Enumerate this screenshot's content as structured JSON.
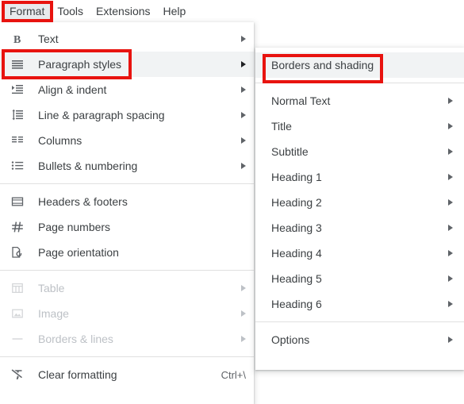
{
  "menubar": {
    "items": [
      {
        "label": "Format",
        "active": true
      },
      {
        "label": "Tools",
        "active": false
      },
      {
        "label": "Extensions",
        "active": false
      },
      {
        "label": "Help",
        "active": false
      }
    ]
  },
  "format_menu": {
    "items": [
      {
        "label": "Text",
        "icon": "bold-b-icon",
        "arrow": true,
        "disabled": false,
        "highlighted": false,
        "shortcut": ""
      },
      {
        "label": "Paragraph styles",
        "icon": "paragraph-lines-icon",
        "arrow": true,
        "disabled": false,
        "highlighted": true,
        "shortcut": ""
      },
      {
        "label": "Align & indent",
        "icon": "align-indent-icon",
        "arrow": true,
        "disabled": false,
        "highlighted": false,
        "shortcut": ""
      },
      {
        "label": "Line & paragraph spacing",
        "icon": "line-spacing-icon",
        "arrow": true,
        "disabled": false,
        "highlighted": false,
        "shortcut": ""
      },
      {
        "label": "Columns",
        "icon": "columns-icon",
        "arrow": true,
        "disabled": false,
        "highlighted": false,
        "shortcut": ""
      },
      {
        "label": "Bullets & numbering",
        "icon": "bullets-numbering-icon",
        "arrow": true,
        "disabled": false,
        "highlighted": false,
        "shortcut": ""
      },
      {
        "separator": true
      },
      {
        "label": "Headers & footers",
        "icon": "headers-footers-icon",
        "arrow": false,
        "disabled": false,
        "highlighted": false,
        "shortcut": ""
      },
      {
        "label": "Page numbers",
        "icon": "hash-icon",
        "arrow": false,
        "disabled": false,
        "highlighted": false,
        "shortcut": ""
      },
      {
        "label": "Page orientation",
        "icon": "page-orientation-icon",
        "arrow": false,
        "disabled": false,
        "highlighted": false,
        "shortcut": ""
      },
      {
        "separator": true
      },
      {
        "label": "Table",
        "icon": "table-icon",
        "arrow": true,
        "disabled": true,
        "highlighted": false,
        "shortcut": ""
      },
      {
        "label": "Image",
        "icon": "image-icon",
        "arrow": true,
        "disabled": true,
        "highlighted": false,
        "shortcut": ""
      },
      {
        "label": "Borders & lines",
        "icon": "borders-lines-icon",
        "arrow": true,
        "disabled": true,
        "highlighted": false,
        "shortcut": ""
      },
      {
        "separator": true
      },
      {
        "label": "Clear formatting",
        "icon": "clear-formatting-icon",
        "arrow": false,
        "disabled": false,
        "highlighted": false,
        "shortcut": "Ctrl+\\"
      }
    ]
  },
  "styles_submenu": {
    "items": [
      {
        "label": "Borders and shading",
        "arrow": false,
        "highlighted": true
      },
      {
        "separator": true
      },
      {
        "label": "Normal Text",
        "arrow": true,
        "highlighted": false
      },
      {
        "label": "Title",
        "arrow": true,
        "highlighted": false
      },
      {
        "label": "Subtitle",
        "arrow": true,
        "highlighted": false
      },
      {
        "label": "Heading 1",
        "arrow": true,
        "highlighted": false
      },
      {
        "label": "Heading 2",
        "arrow": true,
        "highlighted": false
      },
      {
        "label": "Heading 3",
        "arrow": true,
        "highlighted": false
      },
      {
        "label": "Heading 4",
        "arrow": true,
        "highlighted": false
      },
      {
        "label": "Heading 5",
        "arrow": true,
        "highlighted": false
      },
      {
        "label": "Heading 6",
        "arrow": true,
        "highlighted": false
      },
      {
        "separator": true
      },
      {
        "label": "Options",
        "arrow": true,
        "highlighted": false
      }
    ]
  },
  "annotations": {
    "color": "#e8130f",
    "boxes": [
      {
        "name": "format-menubar-highlight"
      },
      {
        "name": "paragraph-styles-highlight"
      },
      {
        "name": "borders-and-shading-highlight"
      }
    ]
  }
}
